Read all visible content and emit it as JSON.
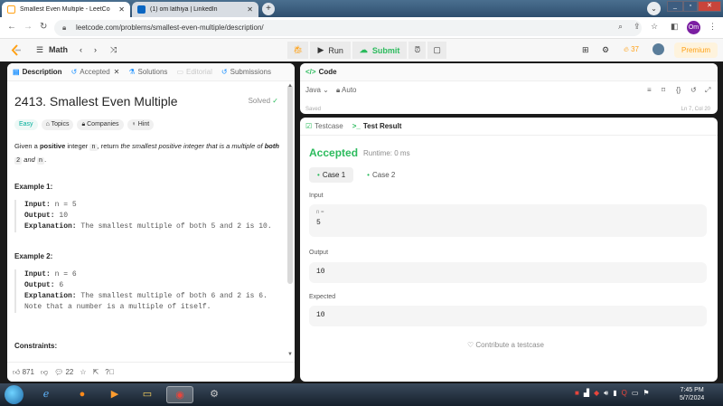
{
  "browser": {
    "tabs": [
      {
        "title": "Smallest Even Multiple - LeetCo",
        "close": "✕"
      },
      {
        "title": "(1) om lathiya | LinkedIn",
        "close": "✕"
      }
    ],
    "url": "leetcode.com/problems/smallest-even-multiple/description/",
    "profile_initials": "Om"
  },
  "lc_header": {
    "menu_label": "Math",
    "run_label": "Run",
    "submit_label": "Submit",
    "streak": "37",
    "premium_label": "Premium"
  },
  "left_tabs": [
    {
      "label": "Description"
    },
    {
      "label": "Accepted"
    },
    {
      "label": "Solutions"
    },
    {
      "label": "Editorial"
    },
    {
      "label": "Submissions"
    }
  ],
  "problem": {
    "title": "2413. Smallest Even Multiple",
    "status": "Solved",
    "difficulty": "Easy",
    "tags": [
      "Topics",
      "Companies",
      "Hint"
    ],
    "desc_1": "Given a ",
    "desc_bold1": "positive",
    "desc_2": " integer ",
    "desc_code_n": "n",
    "desc_3": ", return ",
    "desc_italic": "the smallest positive integer that is a multiple of",
    "desc_bold2": "both",
    "desc_code_2": "2",
    "desc_4": " and ",
    "desc_5": ".",
    "example1": {
      "heading": "Example 1:",
      "input_label": "Input:",
      "input": "n = 5",
      "output_label": "Output:",
      "output": "10",
      "expl_label": "Explanation:",
      "expl": "The smallest multiple of both 5 and 2 is 10."
    },
    "example2": {
      "heading": "Example 2:",
      "input_label": "Input:",
      "input": "n = 6",
      "output_label": "Output:",
      "output": "6",
      "expl_label": "Explanation:",
      "expl": "The smallest multiple of both 6 and 2 is 6. Note that a number is a multiple of itself."
    },
    "constraints_heading": "Constraints:",
    "likes": "871",
    "comments": "22"
  },
  "code_panel": {
    "title": "Code",
    "language": "Java",
    "mode": "Auto",
    "saved": "Saved",
    "position": "Ln 7, Col 20"
  },
  "test_panel": {
    "tab_testcase": "Testcase",
    "tab_result": "Test Result",
    "status": "Accepted",
    "runtime": "Runtime: 0 ms",
    "cases": [
      "Case 1",
      "Case 2"
    ],
    "input_label": "Input",
    "param_name": "n =",
    "input_value": "5",
    "output_label": "Output",
    "output_value": "10",
    "expected_label": "Expected",
    "expected_value": "10",
    "contribute": "Contribute a testcase"
  },
  "taskbar": {
    "time": "7:45 PM",
    "date": "5/7/2024"
  }
}
